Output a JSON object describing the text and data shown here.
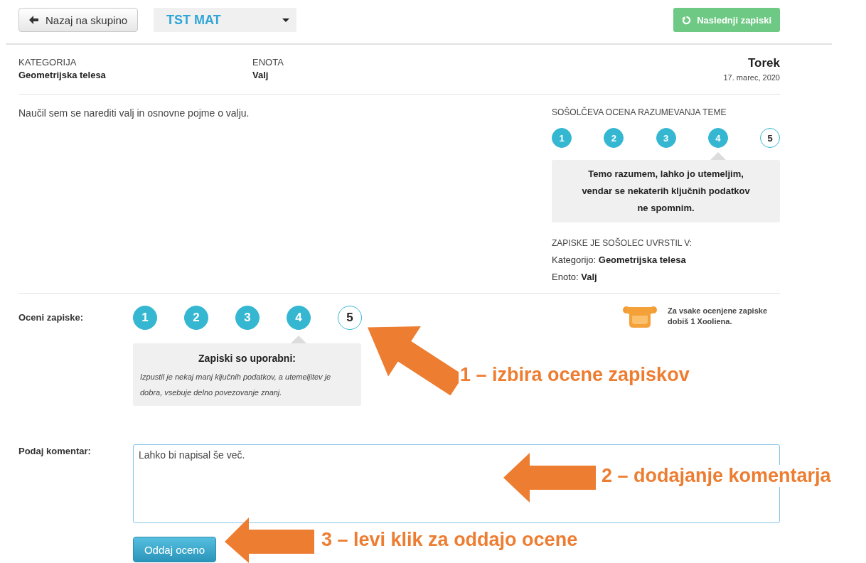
{
  "toolbar": {
    "back_button": "Nazaj na skupino",
    "group_select": {
      "value": "TST MAT"
    },
    "next_button": "Naslednji zapiski"
  },
  "header": {
    "category_label": "KATEGORIJA",
    "category": "Geometrijska telesa",
    "unit_label": "ENOTA",
    "unit": "Valj",
    "day": "Torek",
    "date": "17. marec, 2020"
  },
  "notes_text": "Naučil sem se narediti valj in osnovne pojme o valju.",
  "peer_rating": {
    "title": "SOŠOLČEVA OCENA RAZUMEVANJA TEME",
    "scale": [
      {
        "label": "1",
        "filled": true,
        "selected": false
      },
      {
        "label": "2",
        "filled": true,
        "selected": false
      },
      {
        "label": "3",
        "filled": true,
        "selected": false
      },
      {
        "label": "4",
        "filled": true,
        "selected": true
      },
      {
        "label": "5",
        "filled": false,
        "selected": false
      }
    ],
    "description": "Temo razumem, lahko jo utemeljim, vendar se nekaterih ključnih podatkov ne spomnim."
  },
  "peer_classification": {
    "title": "ZAPISKE JE SOŠOLEC UVRSTIL V:",
    "rows": [
      "Kategorijo: **Geometrijska telesa**",
      "Enoto: **Valj**"
    ]
  },
  "rate_notes": {
    "label": "Oceni zapiske:",
    "scale": [
      {
        "label": "1",
        "filled": true,
        "selected": false
      },
      {
        "label": "2",
        "filled": true,
        "selected": false
      },
      {
        "label": "3",
        "filled": true,
        "selected": false
      },
      {
        "label": "4",
        "filled": true,
        "selected": true
      },
      {
        "label": "5",
        "filled": false,
        "selected": false
      }
    ],
    "tooltip_title": "Zapiski so uporabni:",
    "tooltip_text": "Izpustil je nekaj manj ključnih podatkov, a utemeljitev je dobra, vsebuje delno povezovanje znanj."
  },
  "reward_note": "Za vsake ocenjene zapiske dobiš 1 Xooliena.",
  "comment": {
    "label": "Podaj komentar:",
    "value": "Lahko bi napisal še več."
  },
  "submit_button": "Oddaj oceno",
  "annotations": [
    {
      "kind": "diagonal",
      "text": "1 – izbira ocene zapiskov"
    },
    {
      "kind": "left",
      "text": "2 – dodajanje komentarja"
    },
    {
      "kind": "left",
      "text": "3 – levi klik za oddajo ocene"
    }
  ]
}
